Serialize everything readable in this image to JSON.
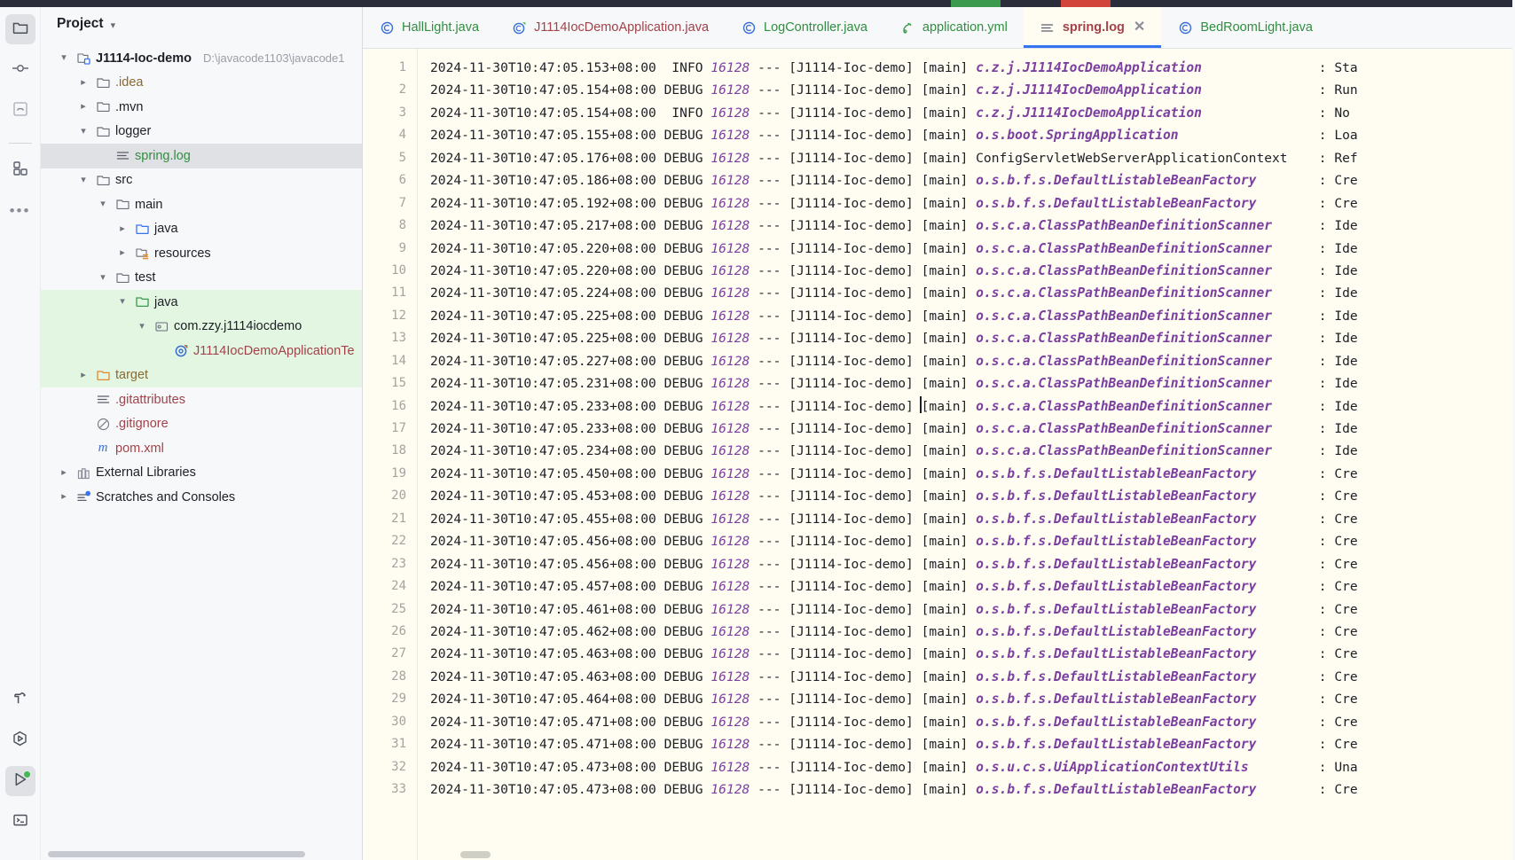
{
  "titlebar": {
    "chip_green": "",
    "chip_red": ""
  },
  "rail": {
    "top_items": [
      {
        "name": "project-tool-window",
        "icon": "folder-icon",
        "active": true
      },
      {
        "name": "commit-tool-window",
        "icon": "commit-node-icon",
        "active": false
      },
      {
        "name": "pull-requests-tool-window",
        "icon": "pull-request-icon",
        "active": false
      }
    ],
    "mid_items": [
      {
        "name": "structure-tool-window",
        "icon": "blocks-icon",
        "active": false
      },
      {
        "name": "more-tool-windows",
        "icon": "ellipsis-icon",
        "active": false
      }
    ],
    "bottom_items": [
      {
        "name": "build-tool-window",
        "icon": "hammer-icon",
        "active": false
      },
      {
        "name": "debug-tool-window",
        "icon": "debug-hexagon-icon",
        "active": false
      },
      {
        "name": "run-tool-window",
        "icon": "run-play-icon",
        "active": true,
        "badge": true
      },
      {
        "name": "terminal-tool-window",
        "icon": "terminal-icon",
        "active": false
      }
    ]
  },
  "project": {
    "title": "Project",
    "dropdown_icon": "chevron-down-icon",
    "tree": [
      {
        "depth": 0,
        "arrow": "down",
        "icon": "module-icon",
        "label": "J1114-Ioc-demo",
        "sub": "D:\\javacode1103\\javacode1",
        "style": "bold",
        "state": "normal"
      },
      {
        "depth": 1,
        "arrow": "right",
        "icon": "folder-icon",
        "label": ".idea",
        "sub": "",
        "style": "brown",
        "state": "normal"
      },
      {
        "depth": 1,
        "arrow": "right",
        "icon": "folder-icon",
        "label": ".mvn",
        "sub": "",
        "style": "plain",
        "state": "normal"
      },
      {
        "depth": 1,
        "arrow": "down",
        "icon": "folder-icon",
        "label": "logger",
        "sub": "",
        "style": "plain",
        "state": "normal"
      },
      {
        "depth": 2,
        "arrow": "none",
        "icon": "log-file-icon",
        "label": "spring.log",
        "sub": "",
        "style": "green",
        "state": "selected"
      },
      {
        "depth": 1,
        "arrow": "down",
        "icon": "folder-icon",
        "label": "src",
        "sub": "",
        "style": "plain",
        "state": "normal"
      },
      {
        "depth": 2,
        "arrow": "down",
        "icon": "folder-icon",
        "label": "main",
        "sub": "",
        "style": "plain",
        "state": "normal"
      },
      {
        "depth": 3,
        "arrow": "right",
        "icon": "source-folder-icon",
        "label": "java",
        "sub": "",
        "style": "plain",
        "state": "normal"
      },
      {
        "depth": 3,
        "arrow": "right",
        "icon": "resource-folder-icon",
        "label": "resources",
        "sub": "",
        "style": "plain",
        "state": "normal"
      },
      {
        "depth": 2,
        "arrow": "down",
        "icon": "folder-icon",
        "label": "test",
        "sub": "",
        "style": "plain",
        "state": "normal"
      },
      {
        "depth": 3,
        "arrow": "down",
        "icon": "test-folder-icon",
        "label": "java",
        "sub": "",
        "style": "plain",
        "state": "green"
      },
      {
        "depth": 4,
        "arrow": "down",
        "icon": "package-icon",
        "label": "com.zzy.j1114iocdemo",
        "sub": "",
        "style": "plain",
        "state": "green"
      },
      {
        "depth": 5,
        "arrow": "none",
        "icon": "test-class-icon",
        "label": "J1114IocDemoApplicationTe",
        "sub": "",
        "style": "red",
        "state": "green"
      },
      {
        "depth": 1,
        "arrow": "right",
        "icon": "target-folder-icon",
        "label": "target",
        "sub": "",
        "style": "brown",
        "state": "green"
      },
      {
        "depth": 1,
        "arrow": "none",
        "icon": "text-file-icon",
        "label": ".gitattributes",
        "sub": "",
        "style": "red",
        "state": "normal"
      },
      {
        "depth": 1,
        "arrow": "none",
        "icon": "gitignore-icon",
        "label": ".gitignore",
        "sub": "",
        "style": "red",
        "state": "normal"
      },
      {
        "depth": 1,
        "arrow": "none",
        "icon": "maven-icon",
        "label": "pom.xml",
        "sub": "",
        "style": "red",
        "state": "normal"
      },
      {
        "depth": 0,
        "arrow": "right",
        "icon": "libraries-icon",
        "label": "External Libraries",
        "sub": "",
        "style": "plain",
        "state": "normal"
      },
      {
        "depth": 0,
        "arrow": "right",
        "icon": "scratches-icon",
        "label": "Scratches and Consoles",
        "sub": "",
        "style": "plain",
        "state": "normal"
      }
    ]
  },
  "tabs": [
    {
      "label": "HallLight.java",
      "icon": "java-class-icon",
      "color": "green",
      "active": false,
      "closable": false
    },
    {
      "label": "J1114IocDemoApplication.java",
      "icon": "spring-class-icon",
      "color": "red",
      "active": false,
      "closable": false
    },
    {
      "label": "LogController.java",
      "icon": "java-class-icon",
      "color": "green",
      "active": false,
      "closable": false
    },
    {
      "label": "application.yml",
      "icon": "yaml-icon",
      "color": "green",
      "active": false,
      "closable": false
    },
    {
      "label": "spring.log",
      "icon": "log-file-icon",
      "color": "red",
      "active": true,
      "closable": true,
      "close_icon": "close-icon"
    },
    {
      "label": "BedRoomLight.java",
      "icon": "java-class-icon",
      "color": "green",
      "active": false,
      "closable": false
    }
  ],
  "log": {
    "app_name": "[J1114-Ioc-demo]",
    "thread": "[main]",
    "pid": "16128",
    "dashes": "---",
    "lines": [
      {
        "n": 1,
        "ts": "2024-11-30T10:47:05.153+08:00",
        "level": "INFO",
        "logger": "c.z.j.J1114IocDemoApplication",
        "logger_plain": false,
        "msg": "Sta"
      },
      {
        "n": 2,
        "ts": "2024-11-30T10:47:05.154+08:00",
        "level": "DEBUG",
        "logger": "c.z.j.J1114IocDemoApplication",
        "logger_plain": false,
        "msg": "Run"
      },
      {
        "n": 3,
        "ts": "2024-11-30T10:47:05.154+08:00",
        "level": "INFO",
        "logger": "c.z.j.J1114IocDemoApplication",
        "logger_plain": false,
        "msg": "No "
      },
      {
        "n": 4,
        "ts": "2024-11-30T10:47:05.155+08:00",
        "level": "DEBUG",
        "logger": "o.s.boot.SpringApplication",
        "logger_plain": false,
        "msg": "Loa"
      },
      {
        "n": 5,
        "ts": "2024-11-30T10:47:05.176+08:00",
        "level": "DEBUG",
        "logger": "ConfigServletWebServerApplicationContext",
        "logger_plain": true,
        "msg": "Ref"
      },
      {
        "n": 6,
        "ts": "2024-11-30T10:47:05.186+08:00",
        "level": "DEBUG",
        "logger": "o.s.b.f.s.DefaultListableBeanFactory",
        "logger_plain": false,
        "msg": "Cre"
      },
      {
        "n": 7,
        "ts": "2024-11-30T10:47:05.192+08:00",
        "level": "DEBUG",
        "logger": "o.s.b.f.s.DefaultListableBeanFactory",
        "logger_plain": false,
        "msg": "Cre"
      },
      {
        "n": 8,
        "ts": "2024-11-30T10:47:05.217+08:00",
        "level": "DEBUG",
        "logger": "o.s.c.a.ClassPathBeanDefinitionScanner",
        "logger_plain": false,
        "msg": "Ide"
      },
      {
        "n": 9,
        "ts": "2024-11-30T10:47:05.220+08:00",
        "level": "DEBUG",
        "logger": "o.s.c.a.ClassPathBeanDefinitionScanner",
        "logger_plain": false,
        "msg": "Ide"
      },
      {
        "n": 10,
        "ts": "2024-11-30T10:47:05.220+08:00",
        "level": "DEBUG",
        "logger": "o.s.c.a.ClassPathBeanDefinitionScanner",
        "logger_plain": false,
        "msg": "Ide"
      },
      {
        "n": 11,
        "ts": "2024-11-30T10:47:05.224+08:00",
        "level": "DEBUG",
        "logger": "o.s.c.a.ClassPathBeanDefinitionScanner",
        "logger_plain": false,
        "msg": "Ide"
      },
      {
        "n": 12,
        "ts": "2024-11-30T10:47:05.225+08:00",
        "level": "DEBUG",
        "logger": "o.s.c.a.ClassPathBeanDefinitionScanner",
        "logger_plain": false,
        "msg": "Ide"
      },
      {
        "n": 13,
        "ts": "2024-11-30T10:47:05.225+08:00",
        "level": "DEBUG",
        "logger": "o.s.c.a.ClassPathBeanDefinitionScanner",
        "logger_plain": false,
        "msg": "Ide"
      },
      {
        "n": 14,
        "ts": "2024-11-30T10:47:05.227+08:00",
        "level": "DEBUG",
        "logger": "o.s.c.a.ClassPathBeanDefinitionScanner",
        "logger_plain": false,
        "msg": "Ide"
      },
      {
        "n": 15,
        "ts": "2024-11-30T10:47:05.231+08:00",
        "level": "DEBUG",
        "logger": "o.s.c.a.ClassPathBeanDefinitionScanner",
        "logger_plain": false,
        "msg": "Ide"
      },
      {
        "n": 16,
        "ts": "2024-11-30T10:47:05.233+08:00",
        "level": "DEBUG",
        "logger": "o.s.c.a.ClassPathBeanDefinitionScanner",
        "logger_plain": false,
        "msg": "Ide"
      },
      {
        "n": 17,
        "ts": "2024-11-30T10:47:05.233+08:00",
        "level": "DEBUG",
        "logger": "o.s.c.a.ClassPathBeanDefinitionScanner",
        "logger_plain": false,
        "msg": "Ide"
      },
      {
        "n": 18,
        "ts": "2024-11-30T10:47:05.234+08:00",
        "level": "DEBUG",
        "logger": "o.s.c.a.ClassPathBeanDefinitionScanner",
        "logger_plain": false,
        "msg": "Ide"
      },
      {
        "n": 19,
        "ts": "2024-11-30T10:47:05.450+08:00",
        "level": "DEBUG",
        "logger": "o.s.b.f.s.DefaultListableBeanFactory",
        "logger_plain": false,
        "msg": "Cre"
      },
      {
        "n": 20,
        "ts": "2024-11-30T10:47:05.453+08:00",
        "level": "DEBUG",
        "logger": "o.s.b.f.s.DefaultListableBeanFactory",
        "logger_plain": false,
        "msg": "Cre"
      },
      {
        "n": 21,
        "ts": "2024-11-30T10:47:05.455+08:00",
        "level": "DEBUG",
        "logger": "o.s.b.f.s.DefaultListableBeanFactory",
        "logger_plain": false,
        "msg": "Cre"
      },
      {
        "n": 22,
        "ts": "2024-11-30T10:47:05.456+08:00",
        "level": "DEBUG",
        "logger": "o.s.b.f.s.DefaultListableBeanFactory",
        "logger_plain": false,
        "msg": "Cre"
      },
      {
        "n": 23,
        "ts": "2024-11-30T10:47:05.456+08:00",
        "level": "DEBUG",
        "logger": "o.s.b.f.s.DefaultListableBeanFactory",
        "logger_plain": false,
        "msg": "Cre"
      },
      {
        "n": 24,
        "ts": "2024-11-30T10:47:05.457+08:00",
        "level": "DEBUG",
        "logger": "o.s.b.f.s.DefaultListableBeanFactory",
        "logger_plain": false,
        "msg": "Cre"
      },
      {
        "n": 25,
        "ts": "2024-11-30T10:47:05.461+08:00",
        "level": "DEBUG",
        "logger": "o.s.b.f.s.DefaultListableBeanFactory",
        "logger_plain": false,
        "msg": "Cre"
      },
      {
        "n": 26,
        "ts": "2024-11-30T10:47:05.462+08:00",
        "level": "DEBUG",
        "logger": "o.s.b.f.s.DefaultListableBeanFactory",
        "logger_plain": false,
        "msg": "Cre"
      },
      {
        "n": 27,
        "ts": "2024-11-30T10:47:05.463+08:00",
        "level": "DEBUG",
        "logger": "o.s.b.f.s.DefaultListableBeanFactory",
        "logger_plain": false,
        "msg": "Cre"
      },
      {
        "n": 28,
        "ts": "2024-11-30T10:47:05.463+08:00",
        "level": "DEBUG",
        "logger": "o.s.b.f.s.DefaultListableBeanFactory",
        "logger_plain": false,
        "msg": "Cre"
      },
      {
        "n": 29,
        "ts": "2024-11-30T10:47:05.464+08:00",
        "level": "DEBUG",
        "logger": "o.s.b.f.s.DefaultListableBeanFactory",
        "logger_plain": false,
        "msg": "Cre"
      },
      {
        "n": 30,
        "ts": "2024-11-30T10:47:05.471+08:00",
        "level": "DEBUG",
        "logger": "o.s.b.f.s.DefaultListableBeanFactory",
        "logger_plain": false,
        "msg": "Cre"
      },
      {
        "n": 31,
        "ts": "2024-11-30T10:47:05.471+08:00",
        "level": "DEBUG",
        "logger": "o.s.b.f.s.DefaultListableBeanFactory",
        "logger_plain": false,
        "msg": "Cre"
      },
      {
        "n": 32,
        "ts": "2024-11-30T10:47:05.473+08:00",
        "level": "DEBUG",
        "logger": "o.s.u.c.s.UiApplicationContextUtils",
        "logger_plain": false,
        "msg": "Una"
      },
      {
        "n": 33,
        "ts": "2024-11-30T10:47:05.473+08:00",
        "level": "DEBUG",
        "logger": "o.s.b.f.s.DefaultListableBeanFactory",
        "logger_plain": false,
        "msg": "Cre"
      }
    ]
  },
  "colors": {
    "accent_blue": "#3574f0",
    "editor_bg": "#fffdf2",
    "panel_bg": "#f7f8fa",
    "logger_purple": "#7b3fa0",
    "selected_bg": "#dfe1e5",
    "test_scope_green": "#e2f6e2"
  }
}
